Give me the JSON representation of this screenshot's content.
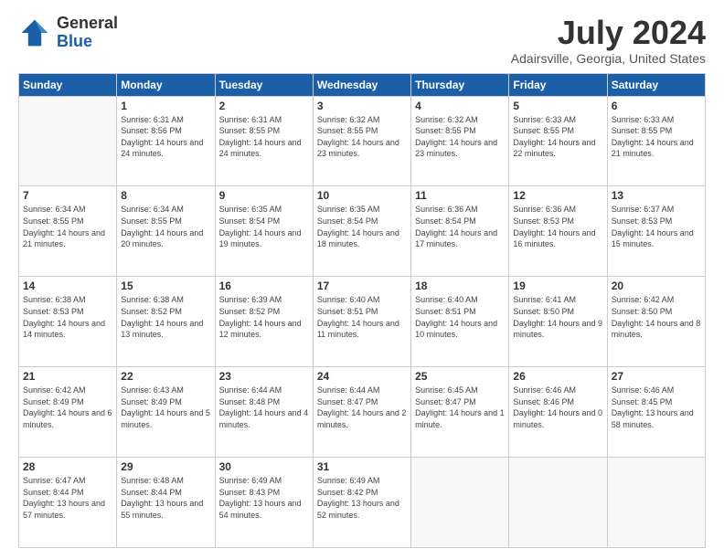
{
  "logo": {
    "general": "General",
    "blue": "Blue"
  },
  "title": {
    "month_year": "July 2024",
    "location": "Adairsville, Georgia, United States"
  },
  "weekdays": [
    "Sunday",
    "Monday",
    "Tuesday",
    "Wednesday",
    "Thursday",
    "Friday",
    "Saturday"
  ],
  "weeks": [
    [
      {
        "day": "",
        "sunrise": "",
        "sunset": "",
        "daylight": ""
      },
      {
        "day": "1",
        "sunrise": "Sunrise: 6:31 AM",
        "sunset": "Sunset: 8:56 PM",
        "daylight": "Daylight: 14 hours and 24 minutes."
      },
      {
        "day": "2",
        "sunrise": "Sunrise: 6:31 AM",
        "sunset": "Sunset: 8:55 PM",
        "daylight": "Daylight: 14 hours and 24 minutes."
      },
      {
        "day": "3",
        "sunrise": "Sunrise: 6:32 AM",
        "sunset": "Sunset: 8:55 PM",
        "daylight": "Daylight: 14 hours and 23 minutes."
      },
      {
        "day": "4",
        "sunrise": "Sunrise: 6:32 AM",
        "sunset": "Sunset: 8:55 PM",
        "daylight": "Daylight: 14 hours and 23 minutes."
      },
      {
        "day": "5",
        "sunrise": "Sunrise: 6:33 AM",
        "sunset": "Sunset: 8:55 PM",
        "daylight": "Daylight: 14 hours and 22 minutes."
      },
      {
        "day": "6",
        "sunrise": "Sunrise: 6:33 AM",
        "sunset": "Sunset: 8:55 PM",
        "daylight": "Daylight: 14 hours and 21 minutes."
      }
    ],
    [
      {
        "day": "7",
        "sunrise": "Sunrise: 6:34 AM",
        "sunset": "Sunset: 8:55 PM",
        "daylight": "Daylight: 14 hours and 21 minutes."
      },
      {
        "day": "8",
        "sunrise": "Sunrise: 6:34 AM",
        "sunset": "Sunset: 8:55 PM",
        "daylight": "Daylight: 14 hours and 20 minutes."
      },
      {
        "day": "9",
        "sunrise": "Sunrise: 6:35 AM",
        "sunset": "Sunset: 8:54 PM",
        "daylight": "Daylight: 14 hours and 19 minutes."
      },
      {
        "day": "10",
        "sunrise": "Sunrise: 6:35 AM",
        "sunset": "Sunset: 8:54 PM",
        "daylight": "Daylight: 14 hours and 18 minutes."
      },
      {
        "day": "11",
        "sunrise": "Sunrise: 6:36 AM",
        "sunset": "Sunset: 8:54 PM",
        "daylight": "Daylight: 14 hours and 17 minutes."
      },
      {
        "day": "12",
        "sunrise": "Sunrise: 6:36 AM",
        "sunset": "Sunset: 8:53 PM",
        "daylight": "Daylight: 14 hours and 16 minutes."
      },
      {
        "day": "13",
        "sunrise": "Sunrise: 6:37 AM",
        "sunset": "Sunset: 8:53 PM",
        "daylight": "Daylight: 14 hours and 15 minutes."
      }
    ],
    [
      {
        "day": "14",
        "sunrise": "Sunrise: 6:38 AM",
        "sunset": "Sunset: 8:53 PM",
        "daylight": "Daylight: 14 hours and 14 minutes."
      },
      {
        "day": "15",
        "sunrise": "Sunrise: 6:38 AM",
        "sunset": "Sunset: 8:52 PM",
        "daylight": "Daylight: 14 hours and 13 minutes."
      },
      {
        "day": "16",
        "sunrise": "Sunrise: 6:39 AM",
        "sunset": "Sunset: 8:52 PM",
        "daylight": "Daylight: 14 hours and 12 minutes."
      },
      {
        "day": "17",
        "sunrise": "Sunrise: 6:40 AM",
        "sunset": "Sunset: 8:51 PM",
        "daylight": "Daylight: 14 hours and 11 minutes."
      },
      {
        "day": "18",
        "sunrise": "Sunrise: 6:40 AM",
        "sunset": "Sunset: 8:51 PM",
        "daylight": "Daylight: 14 hours and 10 minutes."
      },
      {
        "day": "19",
        "sunrise": "Sunrise: 6:41 AM",
        "sunset": "Sunset: 8:50 PM",
        "daylight": "Daylight: 14 hours and 9 minutes."
      },
      {
        "day": "20",
        "sunrise": "Sunrise: 6:42 AM",
        "sunset": "Sunset: 8:50 PM",
        "daylight": "Daylight: 14 hours and 8 minutes."
      }
    ],
    [
      {
        "day": "21",
        "sunrise": "Sunrise: 6:42 AM",
        "sunset": "Sunset: 8:49 PM",
        "daylight": "Daylight: 14 hours and 6 minutes."
      },
      {
        "day": "22",
        "sunrise": "Sunrise: 6:43 AM",
        "sunset": "Sunset: 8:49 PM",
        "daylight": "Daylight: 14 hours and 5 minutes."
      },
      {
        "day": "23",
        "sunrise": "Sunrise: 6:44 AM",
        "sunset": "Sunset: 8:48 PM",
        "daylight": "Daylight: 14 hours and 4 minutes."
      },
      {
        "day": "24",
        "sunrise": "Sunrise: 6:44 AM",
        "sunset": "Sunset: 8:47 PM",
        "daylight": "Daylight: 14 hours and 2 minutes."
      },
      {
        "day": "25",
        "sunrise": "Sunrise: 6:45 AM",
        "sunset": "Sunset: 8:47 PM",
        "daylight": "Daylight: 14 hours and 1 minute."
      },
      {
        "day": "26",
        "sunrise": "Sunrise: 6:46 AM",
        "sunset": "Sunset: 8:46 PM",
        "daylight": "Daylight: 14 hours and 0 minutes."
      },
      {
        "day": "27",
        "sunrise": "Sunrise: 6:46 AM",
        "sunset": "Sunset: 8:45 PM",
        "daylight": "Daylight: 13 hours and 58 minutes."
      }
    ],
    [
      {
        "day": "28",
        "sunrise": "Sunrise: 6:47 AM",
        "sunset": "Sunset: 8:44 PM",
        "daylight": "Daylight: 13 hours and 57 minutes."
      },
      {
        "day": "29",
        "sunrise": "Sunrise: 6:48 AM",
        "sunset": "Sunset: 8:44 PM",
        "daylight": "Daylight: 13 hours and 55 minutes."
      },
      {
        "day": "30",
        "sunrise": "Sunrise: 6:49 AM",
        "sunset": "Sunset: 8:43 PM",
        "daylight": "Daylight: 13 hours and 54 minutes."
      },
      {
        "day": "31",
        "sunrise": "Sunrise: 6:49 AM",
        "sunset": "Sunset: 8:42 PM",
        "daylight": "Daylight: 13 hours and 52 minutes."
      },
      {
        "day": "",
        "sunrise": "",
        "sunset": "",
        "daylight": ""
      },
      {
        "day": "",
        "sunrise": "",
        "sunset": "",
        "daylight": ""
      },
      {
        "day": "",
        "sunrise": "",
        "sunset": "",
        "daylight": ""
      }
    ]
  ]
}
